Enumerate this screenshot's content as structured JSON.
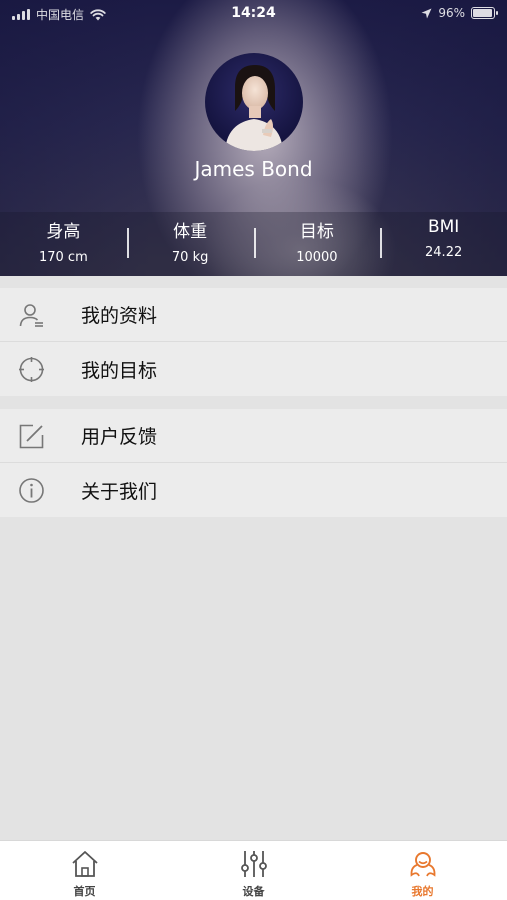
{
  "status_bar": {
    "carrier": "中国电信",
    "time": "14:24",
    "battery": "96%",
    "battery_level": 0.96
  },
  "profile": {
    "name": "James Bond",
    "avatar_icon": "user-avatar"
  },
  "stats": [
    {
      "label": "身高",
      "value": "170 cm"
    },
    {
      "label": "体重",
      "value": "70 kg"
    },
    {
      "label": "目标",
      "value": "10000"
    },
    {
      "label": "BMI",
      "value": "24.22"
    }
  ],
  "menu": {
    "group1": [
      {
        "label": "我的资料",
        "icon": "person-icon"
      },
      {
        "label": "我的目标",
        "icon": "target-icon"
      }
    ],
    "group2": [
      {
        "label": "用户反馈",
        "icon": "edit-icon"
      },
      {
        "label": "关于我们",
        "icon": "info-icon"
      }
    ]
  },
  "tabbar": {
    "tabs": [
      {
        "label": "首页",
        "icon": "home-icon",
        "active": false
      },
      {
        "label": "设备",
        "icon": "sliders-icon",
        "active": false
      },
      {
        "label": "我的",
        "icon": "profile-icon",
        "active": true
      }
    ],
    "active_color": "#e8782e"
  }
}
